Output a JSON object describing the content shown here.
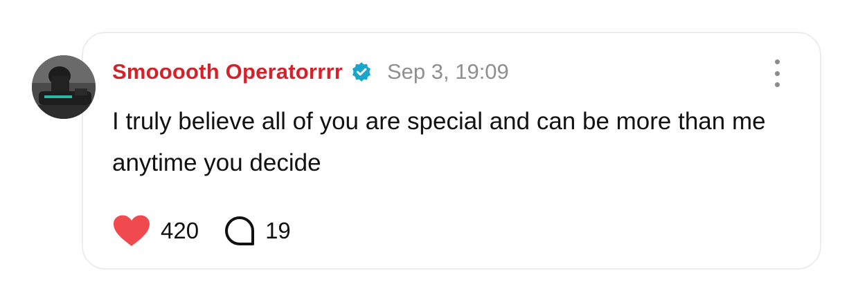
{
  "post": {
    "username": "Smooooth Operatorrrr",
    "verified": true,
    "timestamp": "Sep 3, 19:09",
    "text": "I truly believe all of you are special and can be more than me anytime you decide",
    "likes": "420",
    "comments": "19"
  },
  "colors": {
    "username": "#d3222a",
    "verified_badge": "#1aa6c9",
    "heart": "#f04a4f",
    "timestamp": "#8e8e93"
  },
  "icons": {
    "avatar": "avatar",
    "verified": "verified-badge-icon",
    "more": "more-vertical-icon",
    "like": "heart-icon",
    "comment": "comment-bubble-icon"
  }
}
